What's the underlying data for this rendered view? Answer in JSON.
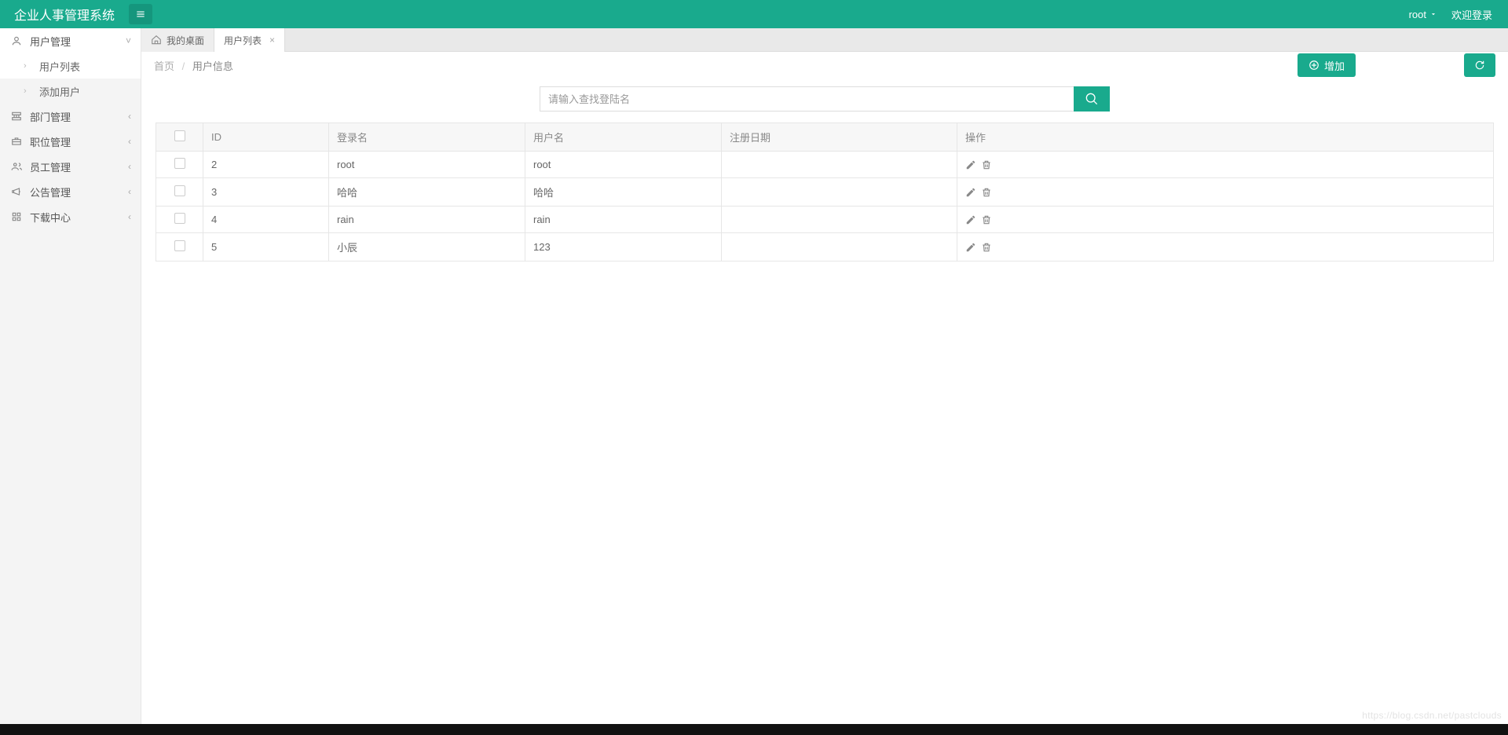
{
  "header": {
    "brand": "企业人事管理系统",
    "user": "root",
    "welcome": "欢迎登录"
  },
  "sidebar": {
    "items": [
      {
        "label": "用户管理",
        "icon": "user",
        "expanded": true,
        "children": [
          {
            "label": "用户列表",
            "active": true
          },
          {
            "label": "添加用户",
            "active": false
          }
        ]
      },
      {
        "label": "部门管理",
        "icon": "sitemap"
      },
      {
        "label": "职位管理",
        "icon": "briefcase"
      },
      {
        "label": "员工管理",
        "icon": "people"
      },
      {
        "label": "公告管理",
        "icon": "megaphone"
      },
      {
        "label": "下载中心",
        "icon": "grid"
      }
    ]
  },
  "tabs": {
    "home": "我的桌面",
    "active": "用户列表"
  },
  "breadcrumb": {
    "root": "首页",
    "current": "用户信息"
  },
  "actions": {
    "add": "增加"
  },
  "search": {
    "placeholder": "请输入查找登陆名"
  },
  "table": {
    "headers": {
      "id": "ID",
      "login": "登录名",
      "user": "用户名",
      "date": "注册日期",
      "op": "操作"
    },
    "rows": [
      {
        "id": "2",
        "login": "root",
        "user": "root",
        "date": ""
      },
      {
        "id": "3",
        "login": "哈哈",
        "user": "哈哈",
        "date": ""
      },
      {
        "id": "4",
        "login": "rain",
        "user": "rain",
        "date": ""
      },
      {
        "id": "5",
        "login": "小辰",
        "user": "123",
        "date": ""
      }
    ]
  },
  "watermark": "https://blog.csdn.net/pastclouds"
}
